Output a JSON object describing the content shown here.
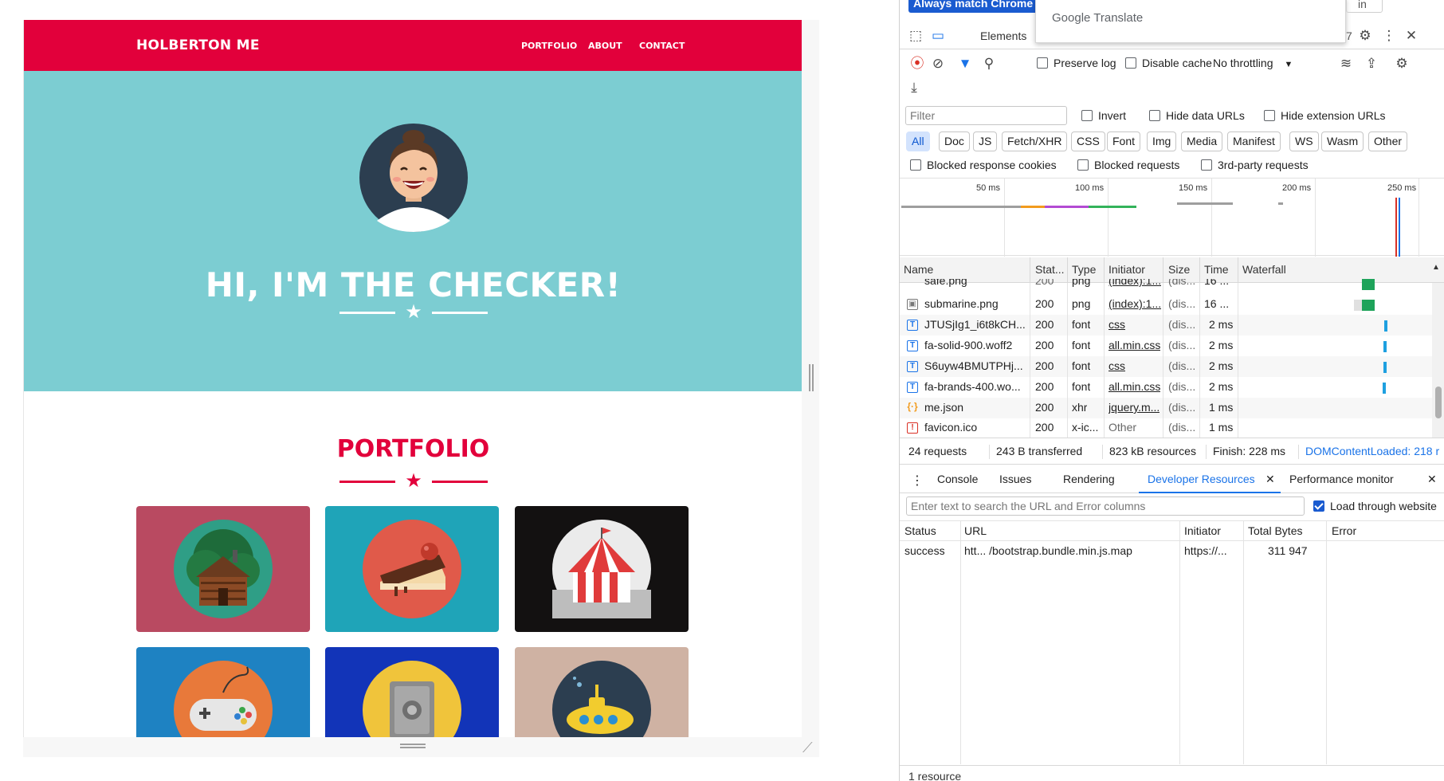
{
  "browser": {
    "infobar_button": "Always match Chrome",
    "translate_popup": "Google Translate",
    "infobar_right": "in"
  },
  "site": {
    "brand": "HOLBERTON ME",
    "nav": [
      "PORTFOLIO",
      "ABOUT",
      "CONTACT"
    ],
    "hero_title": "HI, I'M THE CHECKER!",
    "portfolio_title": "PORTFOLIO",
    "tiles": [
      {
        "icon": "cabin-icon",
        "bg": "#b94a61"
      },
      {
        "icon": "cake-icon",
        "bg": "#1fa4b8"
      },
      {
        "icon": "circus-tent-icon",
        "bg": "#131111"
      },
      {
        "icon": "gamepad-icon",
        "bg": "#1e82c2"
      },
      {
        "icon": "safe-icon",
        "bg": "#1234b8"
      },
      {
        "icon": "submarine-icon",
        "bg": "#cfb2a3"
      }
    ],
    "colors": {
      "primary": "#e2003b",
      "hero": "#7ccdd2"
    }
  },
  "devtools": {
    "tabs": {
      "elements": "Elements",
      "counter": "7"
    },
    "toolbar": {
      "preserve_log": "Preserve log",
      "disable_cache": "Disable cache",
      "throttling": "No throttling"
    },
    "filter": {
      "placeholder": "Filter",
      "invert": "Invert",
      "hide_data_urls": "Hide data URLs",
      "hide_extension_urls": "Hide extension URLs",
      "chips": [
        "All",
        "Doc",
        "JS",
        "Fetch/XHR",
        "CSS",
        "Font",
        "Img",
        "Media",
        "Manifest",
        "WS",
        "Wasm",
        "Other"
      ],
      "blocked_response_cookies": "Blocked response cookies",
      "blocked_requests": "Blocked requests",
      "third_party_requests": "3rd-party requests"
    },
    "overview_ticks": [
      "50 ms",
      "100 ms",
      "150 ms",
      "200 ms",
      "250 ms"
    ],
    "columns": [
      "Name",
      "Stat...",
      "Type",
      "Initiator",
      "Size",
      "Time",
      "Waterfall"
    ],
    "rows": [
      {
        "name": "safe.png",
        "status": "200",
        "type": "png",
        "initiator": "(index):1...",
        "size": "(dis...",
        "time": "16 ..."
      },
      {
        "name": "submarine.png",
        "status": "200",
        "type": "png",
        "initiator": "(index):1...",
        "size": "(dis...",
        "time": "16 ..."
      },
      {
        "name": "JTUSjIg1_i6t8kCH...",
        "status": "200",
        "type": "font",
        "initiator": "css",
        "size": "(dis...",
        "time": "2 ms"
      },
      {
        "name": "fa-solid-900.woff2",
        "status": "200",
        "type": "font",
        "initiator": "all.min.css",
        "size": "(dis...",
        "time": "2 ms"
      },
      {
        "name": "S6uyw4BMUTPHj...",
        "status": "200",
        "type": "font",
        "initiator": "css",
        "size": "(dis...",
        "time": "2 ms"
      },
      {
        "name": "fa-brands-400.wo...",
        "status": "200",
        "type": "font",
        "initiator": "all.min.css",
        "size": "(dis...",
        "time": "2 ms"
      },
      {
        "name": "me.json",
        "status": "200",
        "type": "xhr",
        "initiator": "jquery.m...",
        "size": "(dis...",
        "time": "1 ms"
      },
      {
        "name": "favicon.ico",
        "status": "200",
        "type": "x-ic...",
        "initiator": "Other",
        "size": "(dis...",
        "time": "1 ms"
      }
    ],
    "status_bar": {
      "requests": "24 requests",
      "transferred": "243 B transferred",
      "resources": "823 kB resources",
      "finish": "Finish: 228 ms",
      "dcl": "DOMContentLoaded: 218 r"
    },
    "drawer": {
      "tabs": [
        "Console",
        "Issues",
        "Rendering",
        "Developer Resources",
        "Performance monitor"
      ],
      "search_placeholder": "Enter text to search the URL and Error columns",
      "load_through": "Load through website",
      "columns": [
        "Status",
        "URL",
        "Initiator",
        "Total Bytes",
        "Error"
      ],
      "row": {
        "status": "success",
        "url": "htt... /bootstrap.bundle.min.js.map",
        "initiator": "https://...",
        "bytes": "311 947",
        "error": ""
      },
      "footer": "1 resource"
    }
  }
}
